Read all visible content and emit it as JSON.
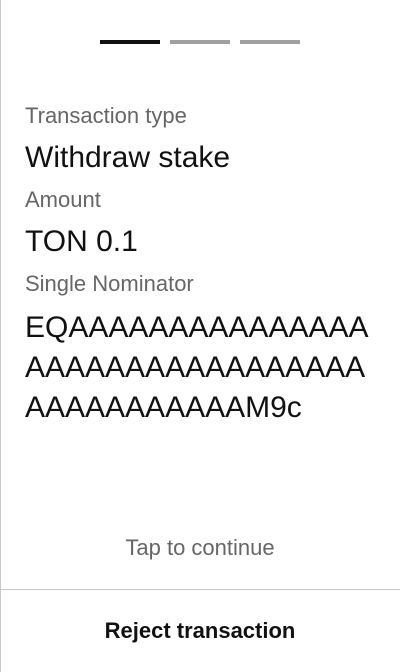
{
  "progress": {
    "total_steps": 3,
    "current_step": 1
  },
  "transaction": {
    "type_label": "Transaction type",
    "type_value": "Withdraw stake",
    "amount_label": "Amount",
    "amount_value": "TON 0.1",
    "nominator_label": "Single Nominator",
    "nominator_address": "EQAAAAAAAAAAAAAAAAAAAAAAAAAAAAAAAAAAAAAAAAAAAM9c"
  },
  "footer": {
    "tap_hint": "Tap to continue",
    "reject_label": "Reject transaction"
  },
  "colors": {
    "text_primary": "#111111",
    "text_secondary": "#666666",
    "progress_active": "#111111",
    "progress_inactive": "#a0a0a0",
    "divider": "#c8c8c8"
  }
}
